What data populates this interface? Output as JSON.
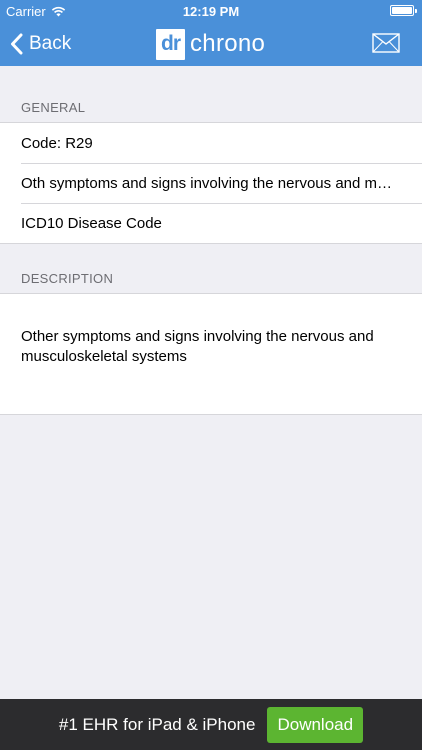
{
  "status_bar": {
    "carrier": "Carrier",
    "time": "12:19 PM"
  },
  "nav": {
    "back_label": "Back",
    "logo_dr": "dr",
    "logo_chrono": "chrono",
    "mail_icon": "mail-icon"
  },
  "general": {
    "header": "GENERAL",
    "rows": [
      "Code: R29",
      "Oth symptoms and signs involving the nervous and m…",
      "ICD10 Disease Code"
    ]
  },
  "description": {
    "header": "DESCRIPTION",
    "text": "Other symptoms and signs involving the nervous and musculoskeletal systems"
  },
  "ad": {
    "text": "#1 EHR for iPad & iPhone",
    "button": "Download"
  },
  "colors": {
    "nav_blue": "#4a90d9",
    "background": "#efeff4",
    "ad_background": "#2c2c2e",
    "download_green": "#5cb531"
  }
}
